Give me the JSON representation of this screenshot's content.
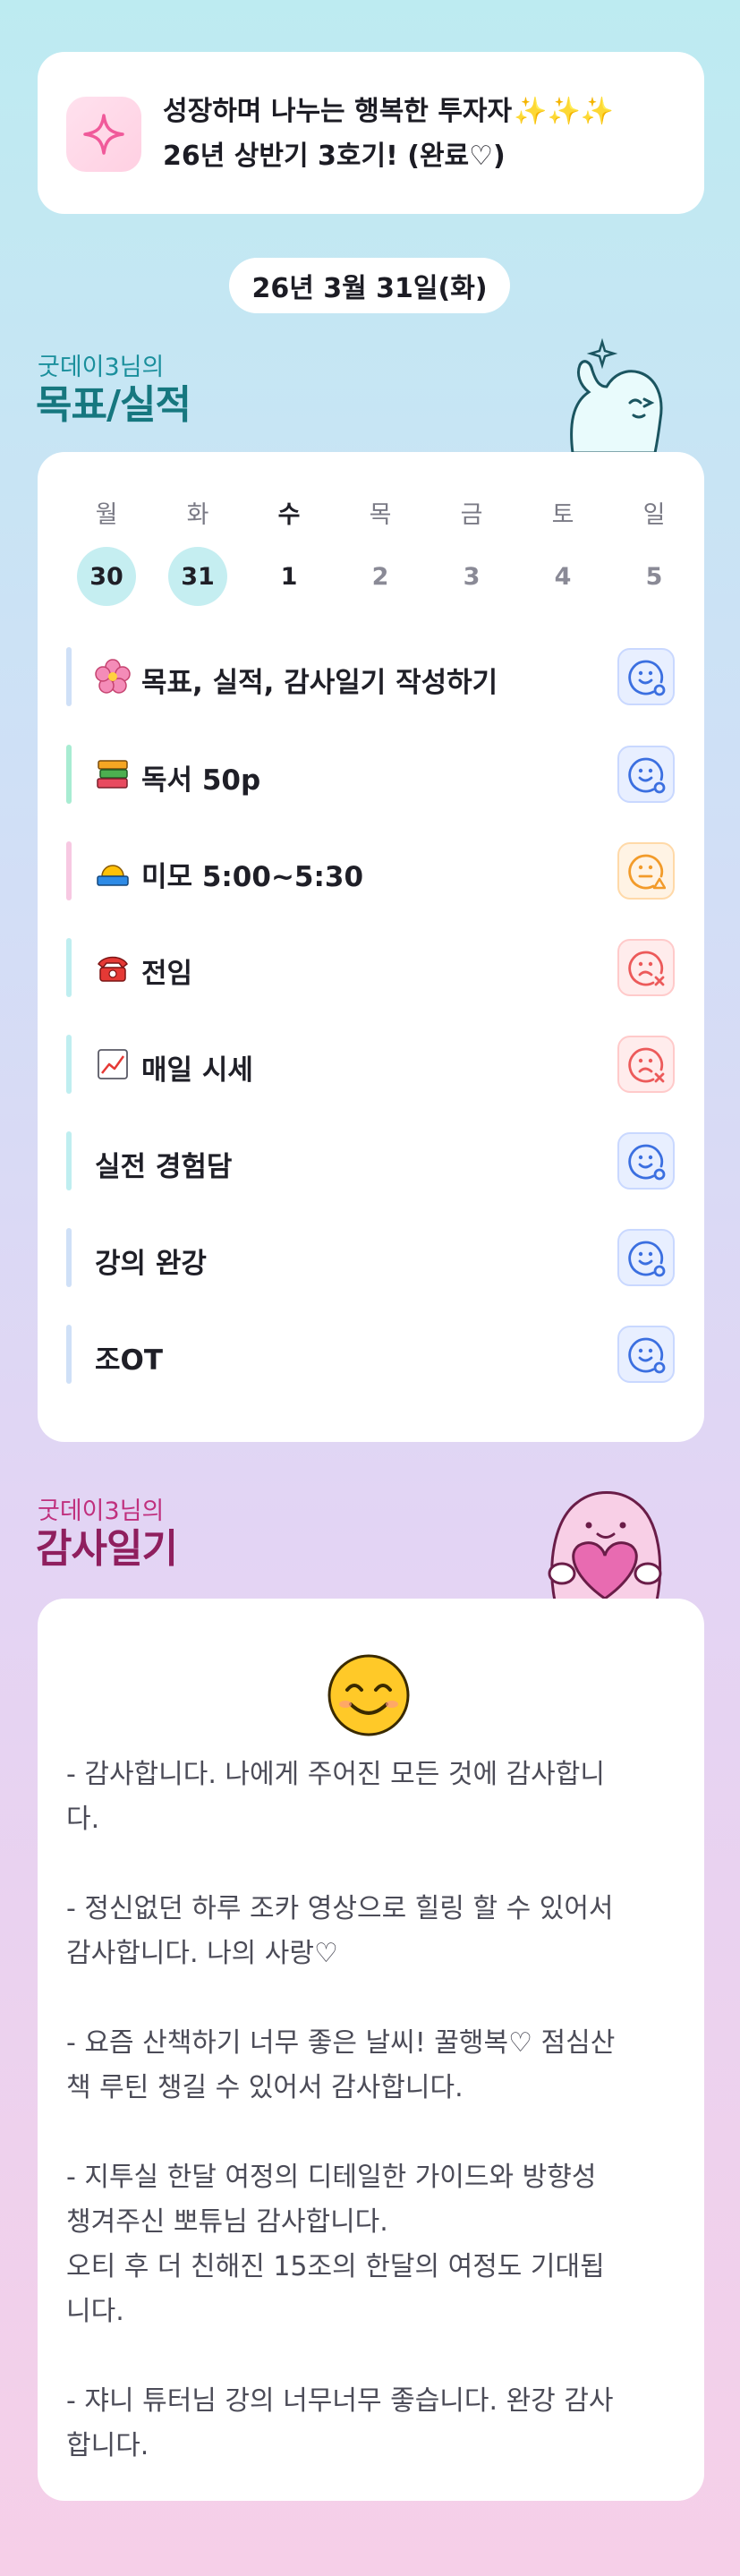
{
  "header": {
    "line1": "성장하며 나누는 행복한 투자자",
    "sparkles": "✨✨✨",
    "line2": "26년 상반기 3호기! (완료♡)",
    "icon": "sparkle-icon"
  },
  "date": "26년 3월 31일(화)",
  "goals_section": {
    "small": "굿데이3님의",
    "big": "목표/실적"
  },
  "week": {
    "days": [
      "월",
      "화",
      "수",
      "목",
      "금",
      "토",
      "일"
    ],
    "dates": [
      "30",
      "31",
      "1",
      "2",
      "3",
      "4",
      "5"
    ]
  },
  "goals": [
    {
      "emoji": "flower-icon",
      "text": "목표, 실적, 감사일기 작성하기",
      "status": "good"
    },
    {
      "emoji": "books-icon",
      "text": "독서 50p",
      "status": "good"
    },
    {
      "emoji": "sunrise-icon",
      "text": "미모 5:00~5:30",
      "status": "mid"
    },
    {
      "emoji": "telephone-icon",
      "text": "전임",
      "status": "bad"
    },
    {
      "emoji": "chart-icon",
      "text": "매일 시세",
      "status": "bad"
    },
    {
      "emoji": "",
      "text": "실전 경험담",
      "status": "good"
    },
    {
      "emoji": "",
      "text": "강의 완강",
      "status": "good"
    },
    {
      "emoji": "",
      "text": "조OT",
      "status": "good"
    }
  ],
  "thanks_section": {
    "small": "굿데이3님의",
    "big": "감사일기"
  },
  "thanks": {
    "face": "smiling-face-icon",
    "paragraphs": [
      [
        "- 감사합니다. 나에게 주어진 모든 것에 감사합니",
        "다."
      ],
      [
        "- 정신없던 하루 조카 영상으로 힐링 할 수 있어서",
        "감사합니다. 나의 사랑♡"
      ],
      [
        "- 요즘 산책하기 너무 좋은 날씨! 꿀행복♡ 점심산",
        "책 루틴 챙길 수 있어서 감사합니다."
      ],
      [
        "- 지투실 한달 여정의 디테일한 가이드와 방향성",
        "챙겨주신 뽀튜님 감사합니다.",
        "오티 후 더 친해진 15조의 한달의 여정도 기대됩",
        "니다."
      ],
      [
        "- 쟈니 튜터님 강의 너무너무 좋습니다. 완강 감사",
        "합니다."
      ]
    ]
  },
  "colors": {
    "bar_blue": "#cfe0f7",
    "bar_green": "#a8ecd2",
    "bar_pink": "#f7c8e2",
    "bar_teal": "#bfeef0",
    "status_good": "#3b6fe0",
    "status_mid": "#f29b2a",
    "status_bad": "#ec5a5a"
  }
}
